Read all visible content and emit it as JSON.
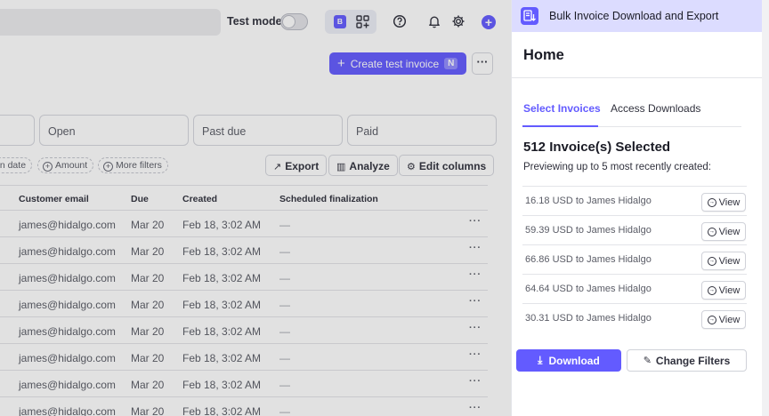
{
  "header": {
    "test_mode_label": "Test mode",
    "badge_letter": "B"
  },
  "actions": {
    "create_label": "Create test invoice",
    "create_shortcut": "N",
    "more_label": "···"
  },
  "status_cards": [
    "Open",
    "Past due",
    "Paid"
  ],
  "filters": [
    "on date",
    "Amount",
    "More filters"
  ],
  "toolbar": {
    "export": "Export",
    "analyze": "Analyze",
    "edit_columns": "Edit columns"
  },
  "table": {
    "columns": [
      "Customer email",
      "Due",
      "Created",
      "Scheduled finalization"
    ],
    "rows": [
      {
        "email": "james@hidalgo.com",
        "due": "Mar 20",
        "created": "Feb 18, 3:02 AM",
        "scheduled": "—"
      },
      {
        "email": "james@hidalgo.com",
        "due": "Mar 20",
        "created": "Feb 18, 3:02 AM",
        "scheduled": "—"
      },
      {
        "email": "james@hidalgo.com",
        "due": "Mar 20",
        "created": "Feb 18, 3:02 AM",
        "scheduled": "—"
      },
      {
        "email": "james@hidalgo.com",
        "due": "Mar 20",
        "created": "Feb 18, 3:02 AM",
        "scheduled": "—"
      },
      {
        "email": "james@hidalgo.com",
        "due": "Mar 20",
        "created": "Feb 18, 3:02 AM",
        "scheduled": "—"
      },
      {
        "email": "james@hidalgo.com",
        "due": "Mar 20",
        "created": "Feb 18, 3:02 AM",
        "scheduled": "—"
      },
      {
        "email": "james@hidalgo.com",
        "due": "Mar 20",
        "created": "Feb 18, 3:02 AM",
        "scheduled": "—"
      },
      {
        "email": "james@hidalgo.com",
        "due": "Mar 20",
        "created": "Feb 18, 3:02 AM",
        "scheduled": "—"
      }
    ],
    "row_menu": "···"
  },
  "panel": {
    "app_title": "Bulk Invoice Download and Export",
    "page_title": "Home",
    "tabs": [
      "Select Invoices",
      "Access Downloads"
    ],
    "selected_title": "512 Invoice(s) Selected",
    "preview_note": "Previewing up to 5 most recently created:",
    "invoices": [
      {
        "text": "16.18 USD to James Hidalgo",
        "action": "View"
      },
      {
        "text": "59.39 USD to James Hidalgo",
        "action": "View"
      },
      {
        "text": "66.86 USD to James Hidalgo",
        "action": "View"
      },
      {
        "text": "64.64 USD to James Hidalgo",
        "action": "View"
      },
      {
        "text": "30.31 USD to James Hidalgo",
        "action": "View"
      }
    ],
    "download_label": "Download",
    "change_filters_label": "Change Filters"
  },
  "colors": {
    "accent": "#635bff",
    "panel_header": "#dcdcff"
  }
}
